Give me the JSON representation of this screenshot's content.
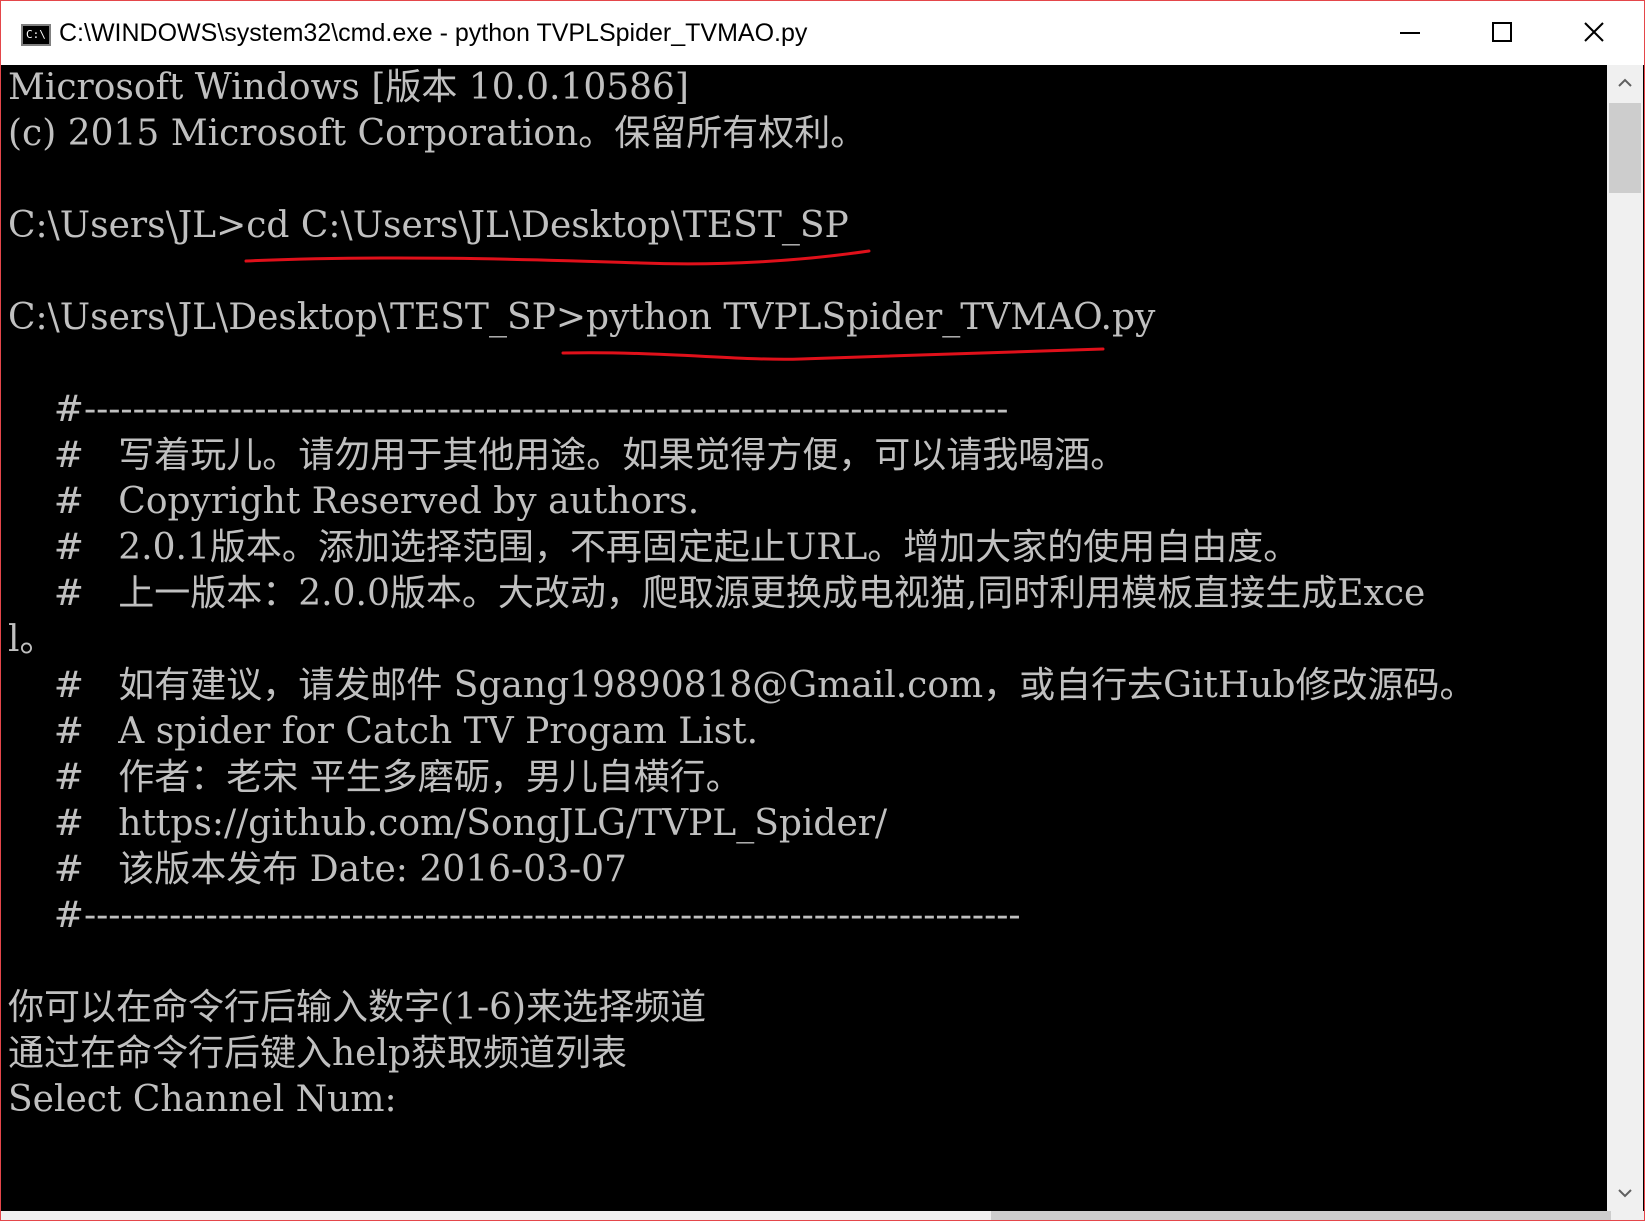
{
  "window": {
    "title": "C:\\WINDOWS\\system32\\cmd.exe - python  TVPLSpider_TVMAO.py",
    "icon_label": "C:\\",
    "minimize_icon": "minimize-icon",
    "maximize_icon": "maximize-icon",
    "close_icon": "close-icon"
  },
  "console": {
    "lines": [
      "Microsoft Windows [版本 10.0.10586]",
      "(c) 2015 Microsoft Corporation。保留所有权利。",
      "",
      "C:\\Users\\JL>cd C:\\Users\\JL\\Desktop\\TEST_SP",
      "",
      "C:\\Users\\JL\\Desktop\\TEST_SP>python TVPLSpider_TVMAO.py",
      "",
      "    #----------------------------------------------------------------------------",
      "    #   写着玩儿。请勿用于其他用途。如果觉得方便，可以请我喝酒。",
      "    #   Copyright Reserved by authors.",
      "    #   2.0.1版本。添加选择范围，不再固定起止URL。增加大家的使用自由度。",
      "    #   上一版本：2.0.0版本。大改动，爬取源更换成电视猫,同时利用模板直接生成Exce",
      "l。",
      "    #   如有建议，请发邮件 Sgang19890818@Gmail.com，或自行去GitHub修改源码。",
      "    #   A spider for Catch TV Progam List.",
      "    #   作者：老宋 平生多磨砺，男儿自横行。",
      "    #   https://github.com/SongJLG/TVPL_Spider/",
      "    #   该版本发布 Date: 2016-03-07",
      "    #-----------------------------------------------------------------------------",
      "",
      "你可以在命令行后输入数字(1-6)来选择频道",
      "通过在命令行后键入help获取频道列表",
      "Select Channel Num:"
    ]
  },
  "colors": {
    "console_bg": "#000000",
    "console_text": "#c0c0c0",
    "annotation": "#e0101a",
    "window_border": "#e4464a"
  }
}
